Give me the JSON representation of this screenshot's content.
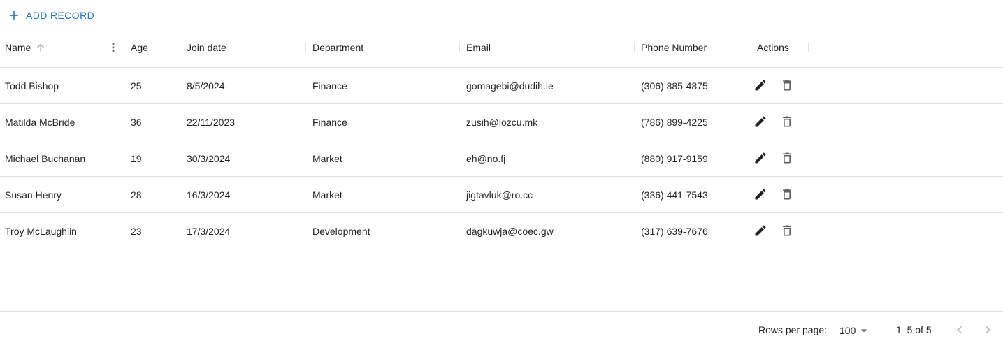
{
  "toolbar": {
    "add_label": "ADD RECORD",
    "accent_color": "#1976d2"
  },
  "columns": {
    "name": "Name",
    "age": "Age",
    "join_date": "Join date",
    "department": "Department",
    "email": "Email",
    "phone": "Phone Number",
    "actions": "Actions"
  },
  "rows": [
    {
      "name": "Todd Bishop",
      "age": "25",
      "join_date": "8/5/2024",
      "department": "Finance",
      "email": "gomagebi@dudih.ie",
      "phone": "(306) 885-4875"
    },
    {
      "name": "Matilda McBride",
      "age": "36",
      "join_date": "22/11/2023",
      "department": "Finance",
      "email": "zusih@lozcu.mk",
      "phone": "(786) 899-4225"
    },
    {
      "name": "Michael Buchanan",
      "age": "19",
      "join_date": "30/3/2024",
      "department": "Market",
      "email": "eh@no.fj",
      "phone": "(880) 917-9159"
    },
    {
      "name": "Susan Henry",
      "age": "28",
      "join_date": "16/3/2024",
      "department": "Market",
      "email": "jigtavluk@ro.cc",
      "phone": "(336) 441-7543"
    },
    {
      "name": "Troy McLaughlin",
      "age": "23",
      "join_date": "17/3/2024",
      "department": "Development",
      "email": "dagkuwja@coec.gw",
      "phone": "(317) 639-7676"
    }
  ],
  "footer": {
    "rows_per_page_label": "Rows per page:",
    "rows_per_page_value": "100",
    "range": "1–5 of 5"
  },
  "icons": {
    "add": "plus-icon",
    "sort": "arrow-up-icon",
    "column_menu": "more-vertical-icon",
    "edit": "pencil-icon",
    "delete": "trash-icon",
    "dropdown": "caret-down-icon",
    "prev": "chevron-left-icon",
    "next": "chevron-right-icon"
  }
}
